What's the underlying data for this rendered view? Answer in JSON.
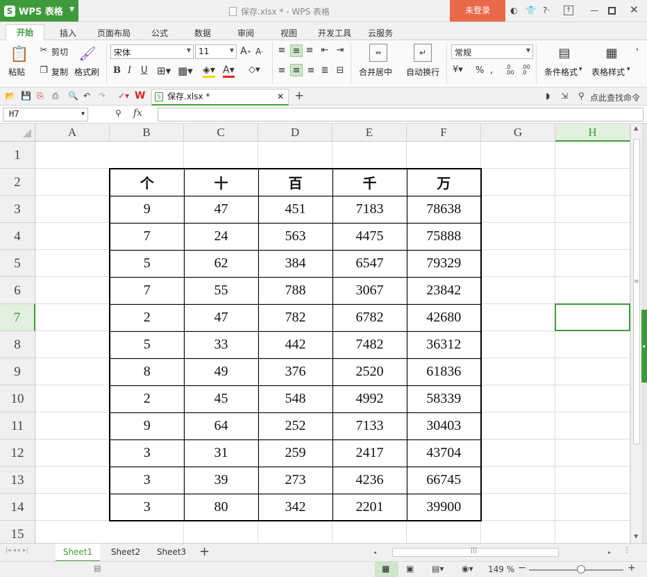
{
  "app": {
    "name": "WPS 表格",
    "logo_letter": "S",
    "accent": "#3f9a3b",
    "login_label": "未登录",
    "login_color": "#e9694b"
  },
  "window_title": "保存.xlsx * - WPS 表格",
  "menu_tabs": [
    "开始",
    "插入",
    "页面布局",
    "公式",
    "数据",
    "审阅",
    "视图",
    "开发工具",
    "云服务"
  ],
  "ribbon": {
    "paste": "粘贴",
    "cut": "剪切",
    "copy": "复制",
    "format_painter": "格式刷",
    "font_name": "宋体",
    "font_size": "11",
    "merge_center": "合并居中",
    "wrap_text": "自动换行",
    "number_format": "常规",
    "cond_format": "条件格式",
    "table_style": "表格样式"
  },
  "doc_tab": "保存.xlsx *",
  "search_cmd": "点此查找命令",
  "name_box": "H7",
  "fx_label": "fx",
  "columns": [
    "A",
    "B",
    "C",
    "D",
    "E",
    "F",
    "G",
    "H"
  ],
  "rows": [
    "1",
    "2",
    "3",
    "4",
    "5",
    "6",
    "7",
    "8",
    "9",
    "10",
    "11",
    "12",
    "13",
    "14",
    "15"
  ],
  "active_cell": {
    "col": "H",
    "row": "7"
  },
  "table": {
    "headers": [
      "个",
      "十",
      "百",
      "千",
      "万"
    ],
    "rows": [
      [
        "9",
        "47",
        "451",
        "7183",
        "78638"
      ],
      [
        "7",
        "24",
        "563",
        "4475",
        "75888"
      ],
      [
        "5",
        "62",
        "384",
        "6547",
        "79329"
      ],
      [
        "7",
        "55",
        "788",
        "3067",
        "23842"
      ],
      [
        "2",
        "47",
        "782",
        "6782",
        "42680"
      ],
      [
        "5",
        "33",
        "442",
        "7482",
        "36312"
      ],
      [
        "8",
        "49",
        "376",
        "2520",
        "61836"
      ],
      [
        "2",
        "45",
        "548",
        "4992",
        "58339"
      ],
      [
        "9",
        "64",
        "252",
        "7133",
        "30403"
      ],
      [
        "3",
        "31",
        "259",
        "2417",
        "43704"
      ],
      [
        "3",
        "39",
        "273",
        "4236",
        "66745"
      ],
      [
        "3",
        "80",
        "342",
        "2201",
        "39900"
      ]
    ]
  },
  "sheets": [
    "Sheet1",
    "Sheet2",
    "Sheet3"
  ],
  "active_sheet": "Sheet1",
  "zoom": "149 %",
  "zoom_level": 0.55
}
